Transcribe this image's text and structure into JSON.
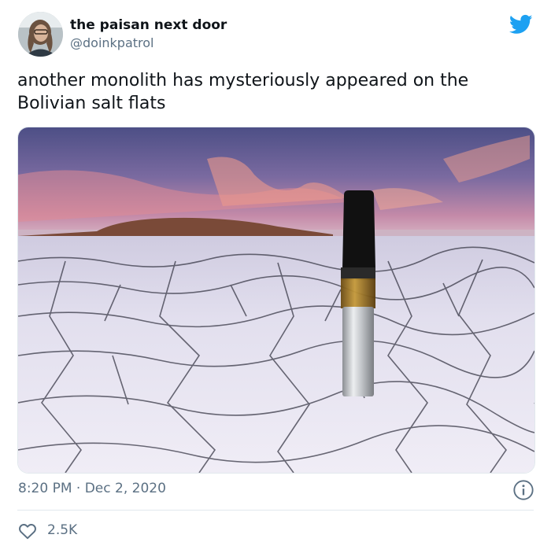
{
  "user": {
    "display_name": "the paisan next door",
    "handle": "@doinkpatrol"
  },
  "tweet": {
    "text": "another monolith has mysteriously appeared on the Bolivian salt flats",
    "timestamp": "8:20 PM · Dec 2, 2020",
    "likes": "2.5K"
  },
  "icons": {
    "brand": "twitter-bird-icon",
    "info": "info-icon",
    "like": "heart-icon"
  },
  "colors": {
    "twitter_blue": "#1da1f2",
    "secondary_text": "#5b7083"
  }
}
